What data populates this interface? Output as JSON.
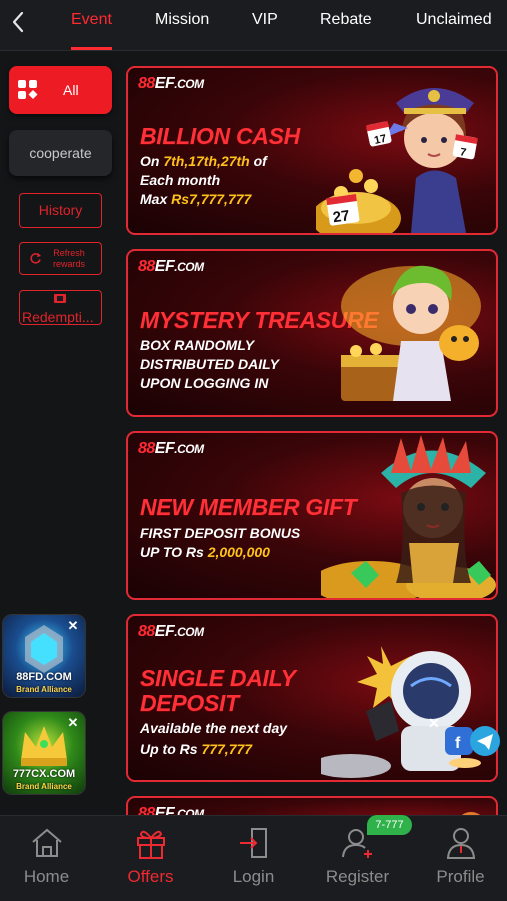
{
  "topnav": {
    "tabs": [
      {
        "label": "Event",
        "active": true
      },
      {
        "label": "Mission"
      },
      {
        "label": "VIP"
      },
      {
        "label": "Rebate"
      },
      {
        "label": "Unclaimed"
      }
    ]
  },
  "sidebar": {
    "all_label": "All",
    "cooperate_label": "cooperate",
    "history_label": "History",
    "refresh_label": "Refresh rewards",
    "redeem_label": "Redempti..."
  },
  "brand": {
    "prefix": "88",
    "main": "EF",
    "suffix": ".COM"
  },
  "banners": [
    {
      "title": "BILLION CASH",
      "line1_a": "On ",
      "line1_b": "7th,17th,27th",
      "line1_c": " of",
      "line2": "Each month",
      "line3_a": "Max ",
      "line3_b": "Rs7,777,777",
      "calendar": [
        "17",
        "7",
        "27"
      ]
    },
    {
      "title": "MYSTERY TREASURE",
      "line1": "BOX RANDOMLY",
      "line2": "DISTRIBUTED DAILY",
      "line3": "UPON LOGGING IN"
    },
    {
      "title": "NEW MEMBER GIFT",
      "line1": "FIRST DEPOSIT BONUS",
      "line2_a": "UP TO Rs ",
      "line2_b": "2,000,000"
    },
    {
      "title_1": "SINGLE DAILY",
      "title_2": "DEPOSIT",
      "line1": "Available the next day",
      "line2_a": "Up to Rs ",
      "line2_b": "777,777"
    }
  ],
  "ads": [
    {
      "name": "88FD.COM",
      "tag": "Brand Alliance",
      "close": "✕"
    },
    {
      "name": "777CX.COM",
      "tag": "Brand Alliance",
      "close": "✕"
    }
  ],
  "bottomnav": {
    "items": [
      {
        "label": "Home",
        "icon": "home-icon"
      },
      {
        "label": "Offers",
        "icon": "gift-icon",
        "active": true
      },
      {
        "label": "Login",
        "icon": "login-icon"
      },
      {
        "label": "Register",
        "icon": "register-icon"
      },
      {
        "label": "Profile",
        "icon": "profile-icon"
      }
    ],
    "register_badge": "7-777"
  },
  "colors": {
    "accent": "#ED1C24",
    "background": "#141517",
    "badge": "#2FB24A",
    "highlight": "#FFC21A"
  }
}
